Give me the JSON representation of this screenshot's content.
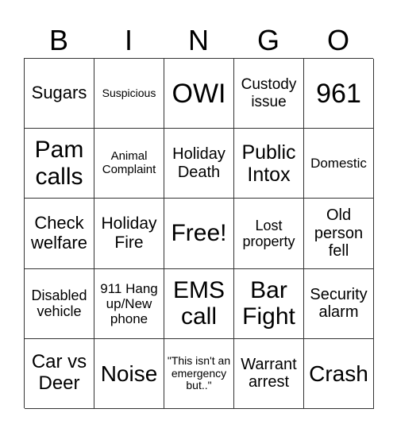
{
  "header": [
    "B",
    "I",
    "N",
    "G",
    "O"
  ],
  "cells": [
    [
      "Sugars",
      "Suspicious",
      "OWI",
      "Custody issue",
      "961"
    ],
    [
      "Pam calls",
      "Animal Complaint",
      "Holiday Death",
      "Public Intox",
      "Domestic"
    ],
    [
      "Check welfare",
      "Holiday Fire",
      "Free!",
      "Lost property",
      "Old person fell"
    ],
    [
      "Disabled vehicle",
      "911 Hang up/New phone",
      "EMS call",
      "Bar Fight",
      "Security alarm"
    ],
    [
      "Car vs Deer",
      "Noise",
      "\"This isn't an emergency but..\"",
      "Warrant arrest",
      "Crash"
    ]
  ]
}
